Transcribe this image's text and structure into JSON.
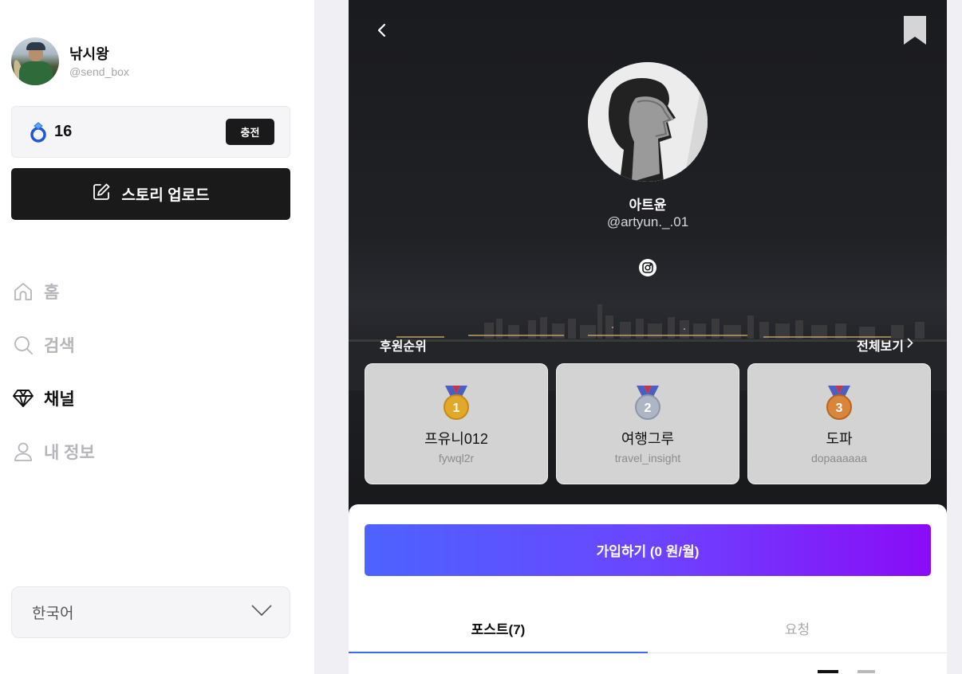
{
  "user": {
    "name": "낚시왕",
    "handle": "@send_box"
  },
  "balance": {
    "value": "16",
    "charge_label": "충전",
    "icon": "ring-icon"
  },
  "upload": {
    "label": "스토리 업로드",
    "icon": "edit-icon"
  },
  "nav": {
    "items": [
      {
        "label": "홈",
        "icon": "home-icon",
        "active": false
      },
      {
        "label": "검색",
        "icon": "search-icon",
        "active": false
      },
      {
        "label": "채널",
        "icon": "diamond-icon",
        "active": true
      },
      {
        "label": "내 정보",
        "icon": "user-icon",
        "active": false
      }
    ]
  },
  "language": {
    "value": "한국어"
  },
  "channel": {
    "name": "아트윤",
    "handle": "@artyun._.01",
    "ranking_title": "후원순위",
    "see_all": "전체보기",
    "ranking": [
      {
        "rank": "1",
        "name": "프유니012",
        "id": "fywql2r",
        "color": "#e2a82a"
      },
      {
        "rank": "2",
        "name": "여행그루",
        "id": "travel_insight",
        "color": "#aeb6c6"
      },
      {
        "rank": "3",
        "name": "도파",
        "id": "dopaaaaaa",
        "color": "#d9853b"
      }
    ],
    "join_label": "가입하기 (0 원/월)",
    "tabs": [
      {
        "label": "포스트(7)",
        "active": true
      },
      {
        "label": "요청",
        "active": false
      }
    ]
  },
  "colors": {
    "accent": "#3e6bf0",
    "join_gradient_start": "#4c63ff",
    "join_gradient_end": "#8a0cf7",
    "dark": "#1a1a1a"
  }
}
